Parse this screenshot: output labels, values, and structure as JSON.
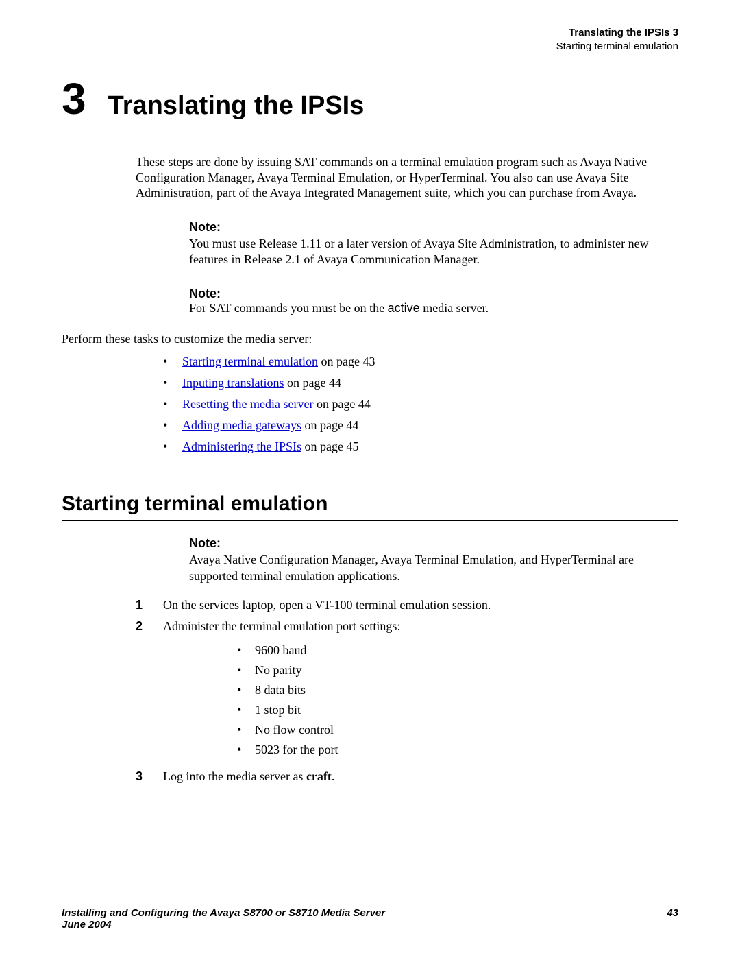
{
  "header": {
    "chapter_line": "Translating the IPSIs 3",
    "sub_line": "Starting terminal emulation"
  },
  "chapter": {
    "number": "3",
    "title": "Translating the IPSIs"
  },
  "intro": "These steps are done by issuing SAT commands on a terminal emulation program such as Avaya Native Configuration Manager, Avaya Terminal Emulation, or HyperTerminal. You also can use Avaya Site Administration, part of the Avaya Integrated Management suite, which you can purchase from Avaya.",
  "note1": {
    "label": "Note:",
    "text": "You must use Release 1.11 or a later version of Avaya Site Administration, to administer new features in Release 2.1 of Avaya Communication Manager."
  },
  "note2": {
    "label": "Note:",
    "prefix": "For SAT commands you must be on the ",
    "code": "active",
    "suffix": " media server."
  },
  "perform_text": "Perform these tasks to customize the media server:",
  "toc": [
    {
      "link": "Starting terminal emulation",
      "suffix": " on page 43"
    },
    {
      "link": "Inputing translations",
      "suffix": " on page 44"
    },
    {
      "link": "Resetting the media server",
      "suffix": " on page 44"
    },
    {
      "link": "Adding media gateways",
      "suffix": " on page 44"
    },
    {
      "link": "Administering the IPSIs",
      "suffix": " on page 45"
    }
  ],
  "section": {
    "heading": "Starting terminal emulation"
  },
  "note3": {
    "label": "Note:",
    "text": "Avaya Native Configuration Manager, Avaya Terminal Emulation, and HyperTerminal are supported terminal emulation applications."
  },
  "steps": {
    "s1_num": "1",
    "s1_text": "On the services laptop, open a VT-100 terminal emulation session.",
    "s2_num": "2",
    "s2_text": "Administer the terminal emulation port settings:",
    "settings": [
      "9600 baud",
      "No parity",
      "8 data bits",
      "1 stop bit",
      "No flow control",
      "5023 for the port"
    ],
    "s3_num": "3",
    "s3_prefix": "Log into the media server as ",
    "s3_bold": "craft",
    "s3_suffix": "."
  },
  "footer": {
    "title": "Installing and Configuring the Avaya S8700 or S8710 Media Server",
    "date": "June 2004",
    "page": "43"
  }
}
